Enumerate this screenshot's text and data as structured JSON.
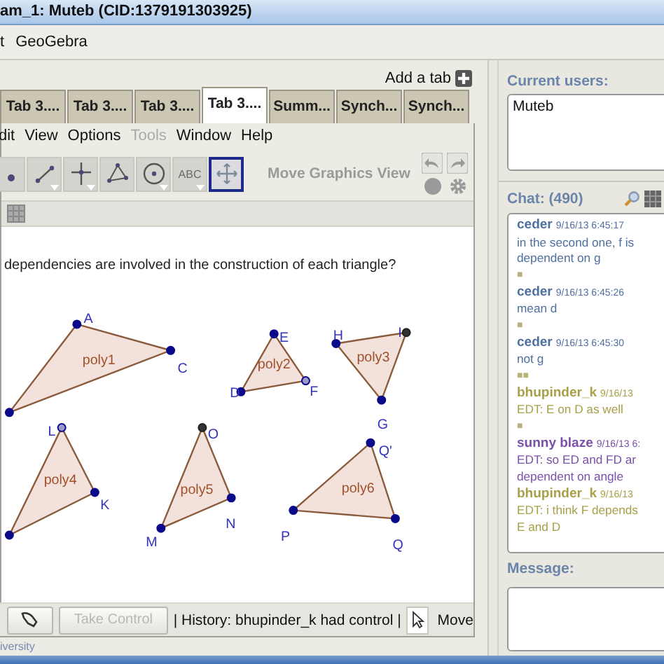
{
  "window": {
    "title": "am_1: Muteb (CID:1379191303925)"
  },
  "menu_bar": [
    "t",
    "GeoGebra"
  ],
  "add_tab": {
    "label": "Add a tab"
  },
  "tabs": [
    {
      "label": "Tab 3....",
      "selected": false
    },
    {
      "label": "Tab 3....",
      "selected": false
    },
    {
      "label": "Tab 3....",
      "selected": false
    },
    {
      "label": "Tab 3....",
      "selected": true
    },
    {
      "label": "Summ...",
      "selected": false
    },
    {
      "label": "Synch...",
      "selected": false
    },
    {
      "label": "Synch...",
      "selected": false
    }
  ],
  "geogebra": {
    "menu": [
      {
        "label": "dit",
        "disabled": false
      },
      {
        "label": "View",
        "disabled": false
      },
      {
        "label": "Options",
        "disabled": false
      },
      {
        "label": "Tools",
        "disabled": true
      },
      {
        "label": "Window",
        "disabled": false
      },
      {
        "label": "Help",
        "disabled": false
      }
    ],
    "tools": [
      {
        "kind": "point",
        "menu": false,
        "selected": false
      },
      {
        "kind": "line",
        "menu": true,
        "selected": false
      },
      {
        "kind": "perpendicular",
        "menu": true,
        "selected": false
      },
      {
        "kind": "polygon",
        "menu": false,
        "selected": false
      },
      {
        "kind": "circle",
        "menu": true,
        "selected": false
      },
      {
        "kind": "text",
        "label": "ABC",
        "menu": true,
        "selected": false
      },
      {
        "kind": "move_view",
        "menu": false,
        "selected": true
      }
    ],
    "tool_hint": "Move Graphics View",
    "question": "dependencies are involved in the construction of each triangle?",
    "polygons": [
      {
        "name": "poly1",
        "points": [
          {
            "label": "A",
            "kind": "free"
          },
          {
            "label": "C",
            "kind": "free"
          },
          {
            "kind": "free"
          }
        ]
      },
      {
        "name": "poly2",
        "points": [
          {
            "label": "E",
            "kind": "free"
          },
          {
            "label": "F",
            "kind": "path"
          },
          {
            "label": "D",
            "kind": "free"
          }
        ]
      },
      {
        "name": "poly3",
        "points": [
          {
            "label": "H",
            "kind": "free"
          },
          {
            "label": "I",
            "kind": "fixed"
          },
          {
            "label": "G",
            "kind": "free"
          }
        ]
      },
      {
        "name": "poly4",
        "points": [
          {
            "label": "L",
            "kind": "path"
          },
          {
            "label": "K",
            "kind": "free"
          },
          {
            "kind": "free"
          }
        ]
      },
      {
        "name": "poly5",
        "points": [
          {
            "label": "O",
            "kind": "fixed"
          },
          {
            "label": "N",
            "kind": "free"
          },
          {
            "label": "M",
            "kind": "free"
          }
        ]
      },
      {
        "name": "poly6",
        "points": [
          {
            "label": "Q'",
            "kind": "free"
          },
          {
            "label": "Q",
            "kind": "free"
          },
          {
            "label": "P",
            "kind": "free"
          }
        ]
      }
    ],
    "take_control": {
      "label": "Take Control",
      "disabled": true
    },
    "history": "| History: bhupinder_k had control |",
    "mode": "Move"
  },
  "footer": "iversity",
  "users_panel": {
    "label": "Current users:",
    "users": [
      "Muteb"
    ]
  },
  "chat": {
    "title": "Chat: (490)",
    "entries": [
      {
        "kind": "message",
        "author": "ceder",
        "time": "9/16/13 6:45:17",
        "color": "#4f6f9f",
        "lines": [
          "in the second one, f is",
          "dependent on g"
        ]
      },
      {
        "kind": "marker",
        "text": "■"
      },
      {
        "kind": "message",
        "author": "ceder",
        "time": "9/16/13 6:45:26",
        "color": "#4f6f9f",
        "lines": [
          "mean d"
        ]
      },
      {
        "kind": "marker",
        "text": "■"
      },
      {
        "kind": "message",
        "author": "ceder",
        "time": "9/16/13 6:45:30",
        "color": "#4f6f9f",
        "lines": [
          "not g"
        ]
      },
      {
        "kind": "marker",
        "text": "■■"
      },
      {
        "kind": "message",
        "author": "bhupinder_k",
        "time": "9/16/13",
        "color": "#a8a048",
        "lines": [
          "EDT: E on D as well"
        ]
      },
      {
        "kind": "marker",
        "text": "■"
      },
      {
        "kind": "message",
        "author": "sunny blaze",
        "time": "9/16/13 6:",
        "color": "#7a50a8",
        "lines": [
          "EDT: so ED and FD ar",
          "dependent on angle"
        ]
      },
      {
        "kind": "message",
        "author": "bhupinder_k",
        "time": "9/16/13",
        "color": "#a8a048",
        "lines": [
          "EDT: i think F depends",
          "E and D"
        ]
      }
    ]
  },
  "message": {
    "label": "Message:"
  }
}
